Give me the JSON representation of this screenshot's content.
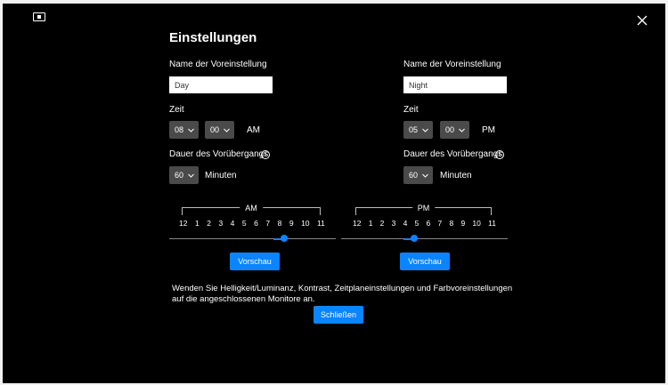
{
  "title": "Einstellungen",
  "left": {
    "preset_label": "Name der Voreinstellung",
    "preset_value": "Day",
    "time_label": "Zeit",
    "hour": "08",
    "minute": "00",
    "period": "AM",
    "duration_label": "Dauer des Vorübergangs",
    "duration": "60",
    "duration_unit": "Minuten",
    "scale_label": "AM",
    "ticks": [
      "12",
      "1",
      "2",
      "3",
      "4",
      "5",
      "6",
      "7",
      "8",
      "9",
      "10",
      "11"
    ],
    "slider_start": 0.625,
    "slider_end": 0.688,
    "preview_label": "Vorschau"
  },
  "right": {
    "preset_label": "Name der Voreinstellung",
    "preset_value": "Night",
    "time_label": "Zeit",
    "hour": "05",
    "minute": "00",
    "period": "PM",
    "duration_label": "Dauer des Vorübergangs",
    "duration": "60",
    "duration_unit": "Minuten",
    "scale_label": "PM",
    "ticks": [
      "12",
      "1",
      "2",
      "3",
      "4",
      "5",
      "6",
      "7",
      "8",
      "9",
      "10",
      "11"
    ],
    "slider_start": 0.375,
    "slider_end": 0.438,
    "preview_label": "Vorschau"
  },
  "description": "Wenden Sie Helligkeit/Luminanz, Kontrast, Zeitplaneinstellungen und Farbvoreinstellungen auf die angeschlossenen Monitore an.",
  "close_label": "Schließen",
  "info_icon_glyph": "i",
  "colors": {
    "accent": "#0a84ff",
    "background": "#000000",
    "dropdown": "#4a4a4a"
  }
}
